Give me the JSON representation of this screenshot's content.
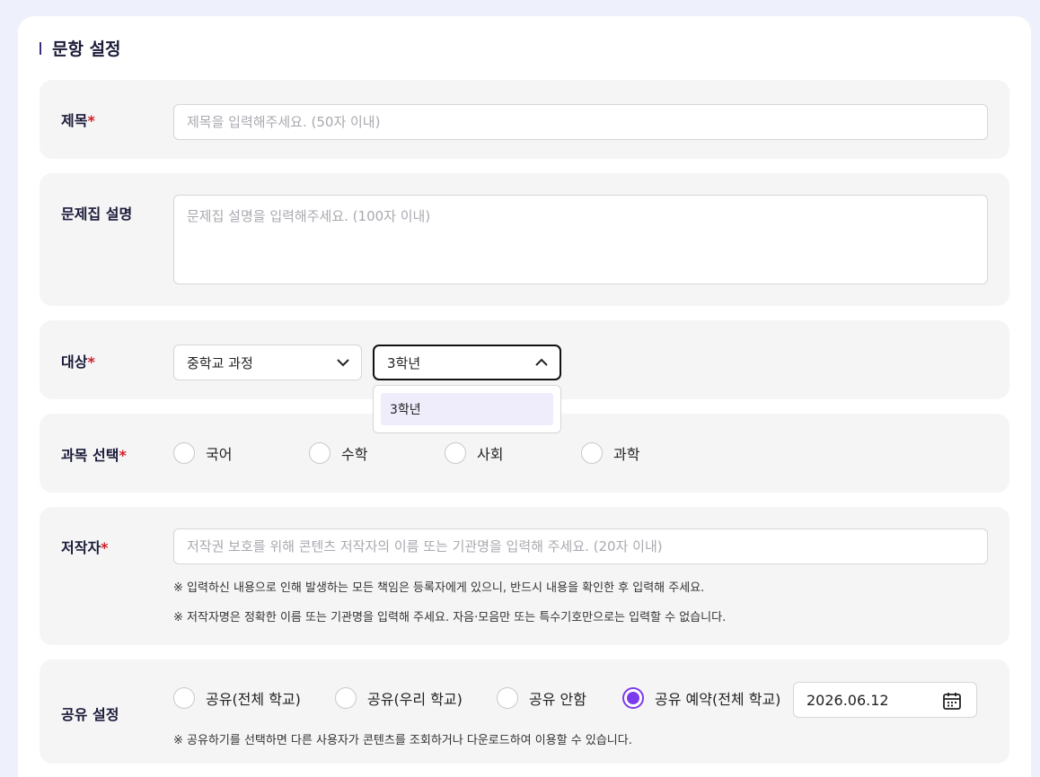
{
  "section": {
    "title": "문항 설정"
  },
  "title_field": {
    "label": "제목",
    "required_mark": "*",
    "placeholder": "제목을 입력해주세요. (50자 이내)",
    "value": ""
  },
  "description_field": {
    "label": "문제집 설명",
    "placeholder": "문제집 설명을 입력해주세요. (100자 이내)",
    "value": ""
  },
  "target_field": {
    "label": "대상",
    "required_mark": "*",
    "level_select": {
      "value": "중학교 과정"
    },
    "grade_select": {
      "value": "3학년",
      "options": [
        "3학년"
      ]
    }
  },
  "subject_field": {
    "label": "과목 선택",
    "required_mark": "*",
    "options": [
      "국어",
      "수학",
      "사회",
      "과학"
    ]
  },
  "author_field": {
    "label": "저작자",
    "required_mark": "*",
    "placeholder": "저작권 보호를 위해 콘텐츠 저작자의 이름 또는 기관명을 입력해 주세요. (20자 이내)",
    "value": "",
    "notes": [
      "※ 입력하신 내용으로 인해 발생하는 모든 책임은 등록자에게 있으니, 반드시 내용을 확인한 후 입력해 주세요.",
      "※ 저작자명은 정확한 이름 또는 기관명을 입력해 주세요. 자음·모음만 또는 특수기호만으로는 입력할 수 없습니다."
    ]
  },
  "share_field": {
    "label": "공유 설정",
    "options": [
      "공유(전체 학교)",
      "공유(우리 학교)",
      "공유 안함",
      "공유 예약(전체 학교)"
    ],
    "selected": "공유 예약(전체 학교)",
    "date": "2026.06.12",
    "note": "※ 공유하기를 선택하면 다른 사용자가 콘텐츠를 조회하거나 다운로드하여 이용할 수 있습니다."
  },
  "colors": {
    "accent": "#7c3aed",
    "required": "#d0202a",
    "panel": "#f5f5f6",
    "page_bg": "#eef1fb"
  }
}
